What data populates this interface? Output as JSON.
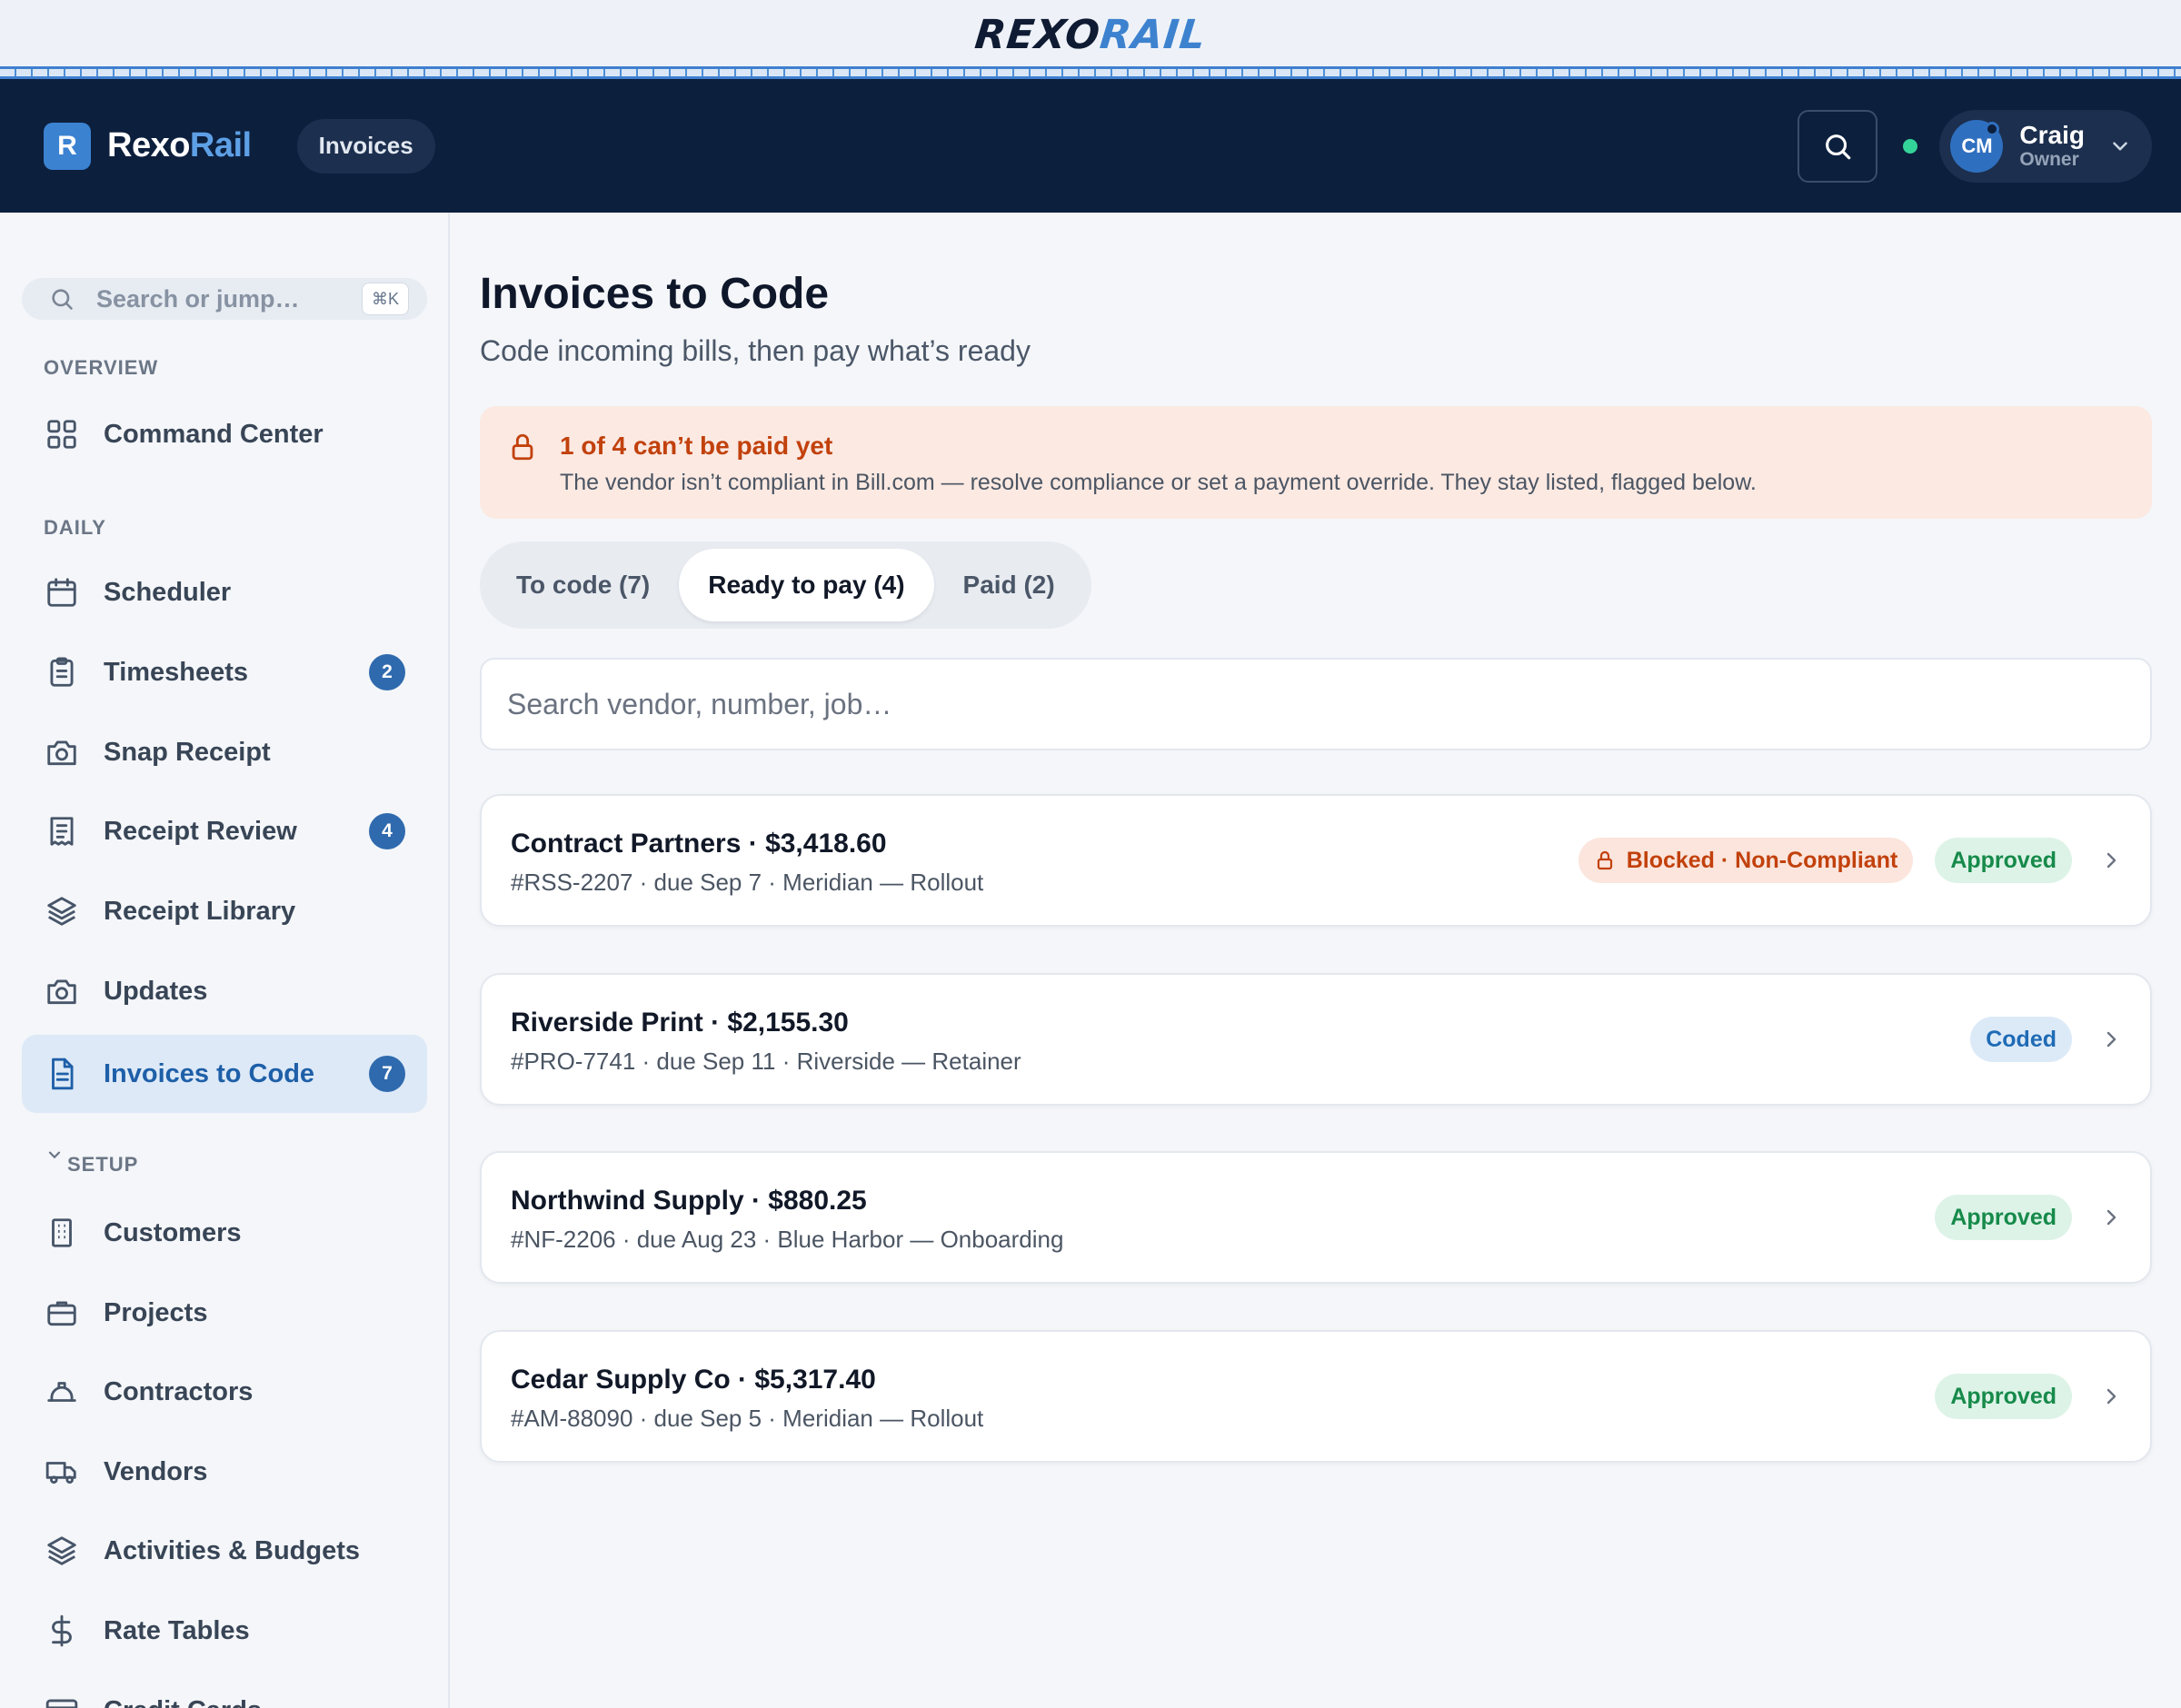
{
  "brand": {
    "wordmark_left": "REXO",
    "wordmark_right": "RAIL",
    "logo_letter": "R",
    "logo_text_left": "Rexo",
    "logo_text_right": "Rail"
  },
  "topnav": {
    "section_chip": "Invoices"
  },
  "user": {
    "initials": "CM",
    "name": "Craig",
    "role": "Owner"
  },
  "sidebar": {
    "search_placeholder": "Search or jump…",
    "shortcut": "⌘K",
    "sections": {
      "overview": "OVERVIEW",
      "daily": "DAILY",
      "setup": "SETUP"
    },
    "items": [
      {
        "label": "Command Center",
        "icon": "grid-icon"
      },
      {
        "label": "Scheduler",
        "icon": "calendar-icon"
      },
      {
        "label": "Timesheets",
        "icon": "clipboard-icon",
        "badge": "2"
      },
      {
        "label": "Snap Receipt",
        "icon": "camera-icon"
      },
      {
        "label": "Receipt Review",
        "icon": "receipt-icon",
        "badge": "4"
      },
      {
        "label": "Receipt Library",
        "icon": "layers-icon"
      },
      {
        "label": "Updates",
        "icon": "camera-icon"
      },
      {
        "label": "Invoices to Code",
        "icon": "file-text-icon",
        "badge": "7",
        "active": true
      },
      {
        "label": "Customers",
        "icon": "building-icon"
      },
      {
        "label": "Projects",
        "icon": "briefcase-icon"
      },
      {
        "label": "Contractors",
        "icon": "hard-hat-icon"
      },
      {
        "label": "Vendors",
        "icon": "truck-icon"
      },
      {
        "label": "Activities & Budgets",
        "icon": "layers-icon"
      },
      {
        "label": "Rate Tables",
        "icon": "dollar-icon"
      },
      {
        "label": "Credit Cards",
        "icon": "credit-card-icon"
      }
    ]
  },
  "main": {
    "title": "Invoices to Code",
    "subtitle": "Code incoming bills, then pay what’s ready",
    "alert": {
      "title": "1 of 4 can’t be paid yet",
      "body": "The vendor isn’t compliant in Bill.com — resolve compliance or set a payment override. They stay listed, flagged below."
    },
    "tabs": [
      {
        "label": "To code (7)"
      },
      {
        "label": "Ready to pay (4)",
        "active": true
      },
      {
        "label": "Paid (2)"
      }
    ],
    "search_placeholder": "Search vendor, number, job…",
    "invoices": [
      {
        "title": "Contract Partners · $3,418.60",
        "meta": "#RSS-2207 · due Sep 7 · Meridian — Rollout",
        "blocked": "Blocked · Non-Compliant",
        "status": "Approved"
      },
      {
        "title": "Riverside Print · $2,155.30",
        "meta": "#PRO-7741 · due Sep 11 · Riverside — Retainer",
        "status": "Coded"
      },
      {
        "title": "Northwind Supply · $880.25",
        "meta": "#NF-2206 · due Aug 23 · Blue Harbor — Onboarding",
        "status": "Approved"
      },
      {
        "title": "Cedar Supply Co · $5,317.40",
        "meta": "#AM-88090 · due Sep 5 · Meridian — Rollout",
        "status": "Approved"
      }
    ]
  },
  "colors": {
    "nav_bg": "#0c1f3d",
    "accent": "#3b82d1",
    "alert_bg": "#fbe9e2",
    "alert_text": "#c2410c",
    "approved": "#168a4a",
    "coded": "#1f6bb5"
  }
}
